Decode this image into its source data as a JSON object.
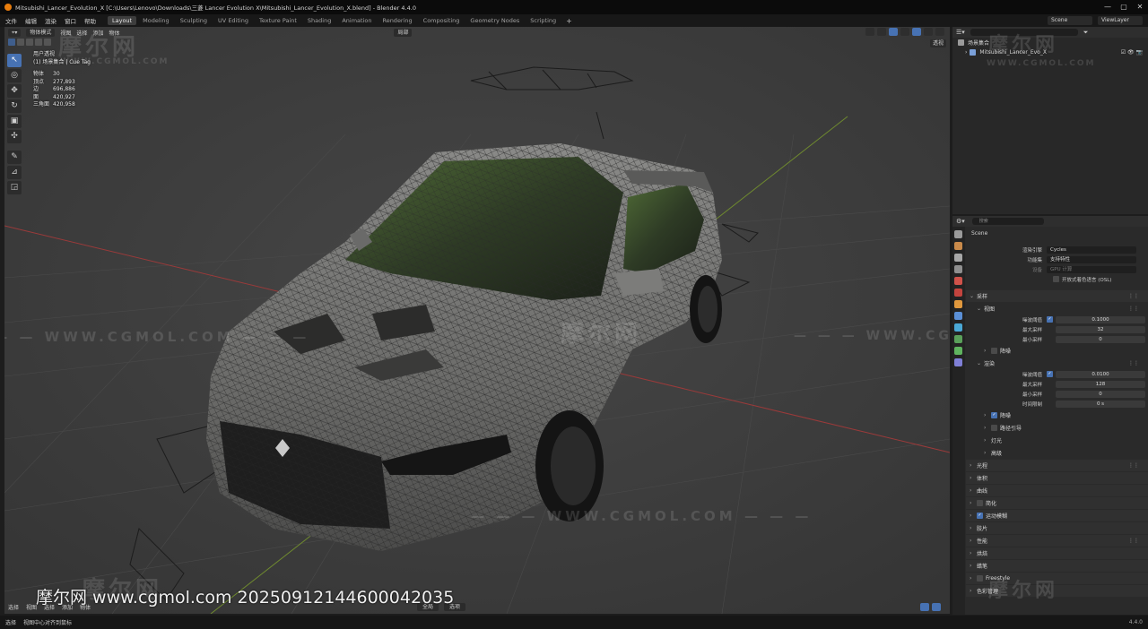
{
  "window": {
    "title": "Mitsubishi_Lancer_Evolution_X [C:\\Users\\Lenovo\\Downloads\\三菱 Lancer Evolution X\\Mitsubishi_Lancer_Evolution_X.blend] - Blender 4.4.0",
    "controls": [
      "—",
      "▢",
      "✕"
    ]
  },
  "menus": [
    "文件",
    "编辑",
    "渲染",
    "窗口",
    "帮助"
  ],
  "workspaces": [
    {
      "label": "Layout",
      "active": true
    },
    {
      "label": "Modeling",
      "active": false
    },
    {
      "label": "Sculpting",
      "active": false
    },
    {
      "label": "UV Editing",
      "active": false
    },
    {
      "label": "Texture Paint",
      "active": false
    },
    {
      "label": "Shading",
      "active": false
    },
    {
      "label": "Animation",
      "active": false
    },
    {
      "label": "Rendering",
      "active": false
    },
    {
      "label": "Compositing",
      "active": false
    },
    {
      "label": "Geometry Nodes",
      "active": false
    },
    {
      "label": "Scripting",
      "active": false
    }
  ],
  "scene_selector": "Scene",
  "viewlayer_selector": "ViewLayer",
  "viewport": {
    "mode": "物体模式",
    "menus": [
      "视图",
      "选择",
      "添加",
      "物体"
    ],
    "orientation": "局部",
    "transparency_button": "透视",
    "view_name": "用户透视",
    "collection_line": "(1) 场景集合 | Cue Tag",
    "stats": [
      {
        "k": "物体",
        "v": "30"
      },
      {
        "k": "顶点",
        "v": "277,893"
      },
      {
        "k": "边",
        "v": "696,886"
      },
      {
        "k": "面",
        "v": "420,927"
      },
      {
        "k": "三角面",
        "v": "420,958"
      }
    ],
    "bottom_items": [
      "选择",
      "视图",
      "选择",
      "添加",
      "物体"
    ],
    "bottom_mid": [
      "全局",
      "选项"
    ]
  },
  "watermarks": {
    "cn": "摩尔网",
    "en": "WWW.CGMOL.COM",
    "line": "— — — WWW.CGMOL.COM — — —"
  },
  "footer_overlay": "摩尔网 www.cgmol.com 20250912144600042035",
  "outliner": {
    "root": "场景集合",
    "item": "Mitsubishi_Lancer_Evo_X",
    "vis": "☑ 👁 📷"
  },
  "properties": {
    "search_placeholder": "搜索",
    "crumb": "Scene",
    "render_engine_label": "渲染引擎",
    "render_engine": "Cycles",
    "feature_set_label": "功能集",
    "feature_set": "支持特性",
    "device_label": "设备",
    "device": "GPU 计算",
    "osl_label": "开放式着色语言 (OSL)",
    "sampling_section": "采样",
    "viewport_sub": "视图",
    "vp_noise_label": "噪波阈值",
    "vp_noise": "0.1000",
    "vp_max_label": "最大采样",
    "vp_max": "32",
    "vp_min_label": "最小采样",
    "vp_min": "0",
    "denoise_sub": "降噪",
    "render_sub": "渲染",
    "r_noise_label": "噪波阈值",
    "r_noise": "0.0100",
    "r_max_label": "最大采样",
    "r_max": "128",
    "r_min_label": "最小采样",
    "r_min": "0",
    "r_time_label": "时间限制",
    "r_time": "0 s",
    "sections_sub": [
      {
        "label": "降噪",
        "check": true
      },
      {
        "label": "路径引导",
        "check": false
      },
      {
        "label": "灯光",
        "check": null
      },
      {
        "label": "高级",
        "check": null
      }
    ],
    "sections": [
      {
        "label": "光程",
        "check": null,
        "menu": true
      },
      {
        "label": "体积",
        "check": null,
        "menu": false
      },
      {
        "label": "曲线",
        "check": null,
        "menu": false
      },
      {
        "label": "简化",
        "check": false,
        "menu": false
      },
      {
        "label": "运动模糊",
        "check": true,
        "menu": false
      },
      {
        "label": "胶片",
        "check": null,
        "menu": false
      },
      {
        "label": "性能",
        "check": null,
        "menu": true
      },
      {
        "label": "烘焙",
        "check": null,
        "menu": false
      },
      {
        "label": "蜡笔",
        "check": null,
        "menu": false
      },
      {
        "label": "Freestyle",
        "check": false,
        "menu": false
      },
      {
        "label": "色彩管理",
        "check": null,
        "menu": false
      }
    ]
  },
  "statusbar": {
    "left1": "选择",
    "left2": "视图中心对齐到鼠标",
    "version": "4.4.0"
  }
}
